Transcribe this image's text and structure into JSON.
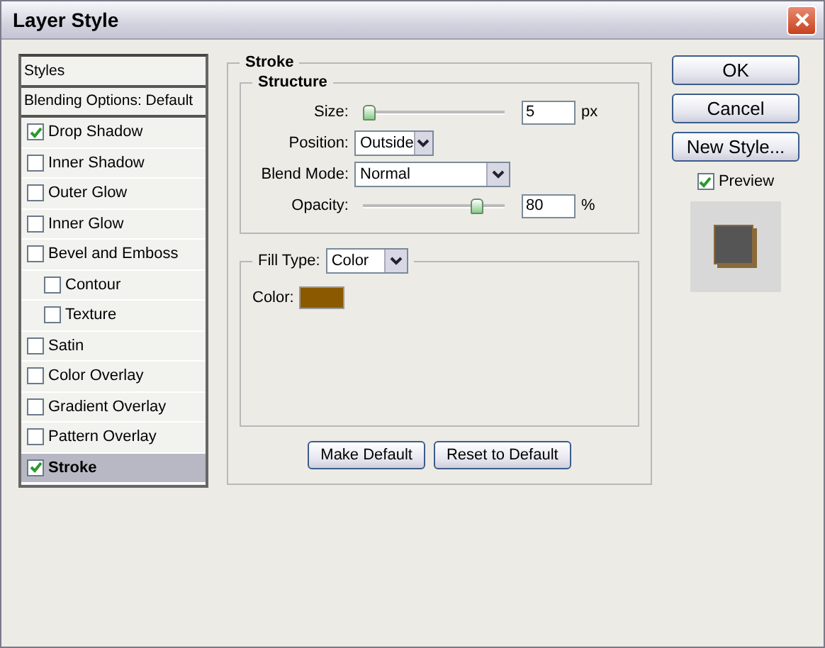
{
  "window": {
    "title": "Layer Style"
  },
  "styles_list": [
    {
      "label": "Styles",
      "kind": "header",
      "selected": false
    },
    {
      "label": "Blending Options: Default",
      "kind": "header",
      "selected": false
    },
    {
      "label": "Drop Shadow",
      "kind": "effect",
      "checked": true,
      "selected": false
    },
    {
      "label": "Inner Shadow",
      "kind": "effect",
      "checked": false,
      "selected": false
    },
    {
      "label": "Outer Glow",
      "kind": "effect",
      "checked": false,
      "selected": false
    },
    {
      "label": "Inner Glow",
      "kind": "effect",
      "checked": false,
      "selected": false
    },
    {
      "label": "Bevel and Emboss",
      "kind": "effect",
      "checked": false,
      "selected": false,
      "children": [
        {
          "label": "Contour",
          "kind": "effect",
          "checked": false,
          "selected": false
        },
        {
          "label": "Texture",
          "kind": "effect",
          "checked": false,
          "selected": false
        }
      ]
    },
    {
      "label": "Satin",
      "kind": "effect",
      "checked": false,
      "selected": false
    },
    {
      "label": "Color Overlay",
      "kind": "effect",
      "checked": false,
      "selected": false
    },
    {
      "label": "Gradient Overlay",
      "kind": "effect",
      "checked": false,
      "selected": false
    },
    {
      "label": "Pattern Overlay",
      "kind": "effect",
      "checked": false,
      "selected": false
    },
    {
      "label": "Stroke",
      "kind": "effect",
      "checked": true,
      "selected": true
    }
  ],
  "stroke": {
    "title": "Stroke",
    "structure": {
      "title": "Structure",
      "size": {
        "label": "Size:",
        "value": "5",
        "unit": "px",
        "level": 0.03
      },
      "position": {
        "label": "Position:",
        "value": "Outside"
      },
      "blend_mode": {
        "label": "Blend Mode:",
        "value": "Normal"
      },
      "opacity": {
        "label": "Opacity:",
        "value": "80",
        "unit": "%",
        "level": 0.8
      }
    },
    "fill": {
      "label": "Fill Type:",
      "value": "Color",
      "color_label": "Color:",
      "color": "#8b5a00"
    },
    "buttons": [
      "Make Default",
      "Reset to Default"
    ]
  },
  "actions": [
    "OK",
    "Cancel",
    "New Style..."
  ],
  "preview": {
    "label": "Preview",
    "checked": true
  }
}
